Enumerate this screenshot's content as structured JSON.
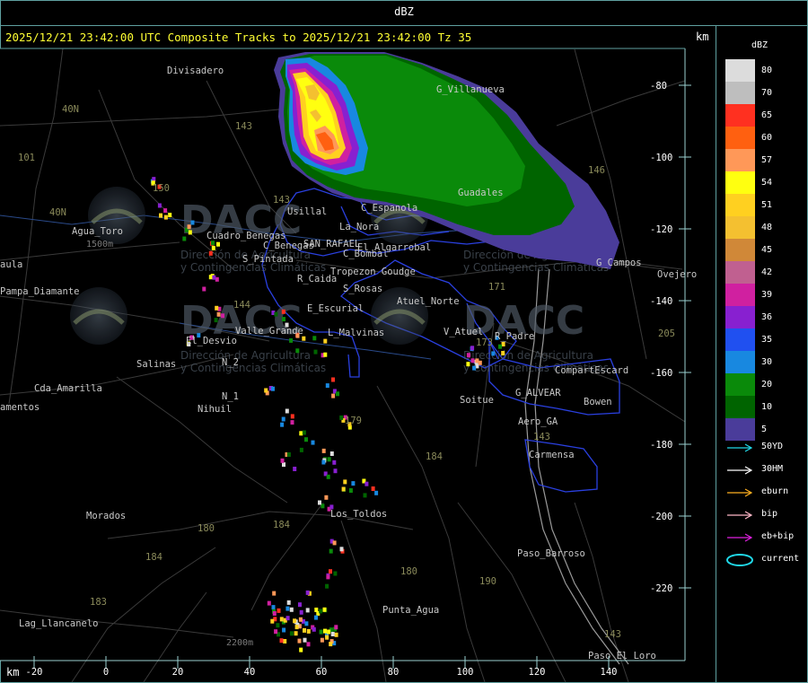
{
  "header": {
    "title": "dBZ"
  },
  "subtitle": "2025/12/21 23:42:00 UTC Composite Tracks to 2025/12/21 23:42:00 Tz 35",
  "axis_unit_top": "km",
  "axis_unit_bottom": "km",
  "y_ticks": [
    "-80",
    "-100",
    "-120",
    "-140",
    "-160",
    "-180",
    "-200",
    "-220"
  ],
  "x_ticks": [
    "-20",
    "0",
    "20",
    "40",
    "60",
    "80",
    "100",
    "120",
    "140"
  ],
  "legend": {
    "title": "dBZ",
    "levels": [
      {
        "label": "80",
        "color": "#dcdcdc"
      },
      {
        "label": "70",
        "color": "#bebebe"
      },
      {
        "label": "65",
        "color": "#ff3020"
      },
      {
        "label": "60",
        "color": "#ff6010"
      },
      {
        "label": "57",
        "color": "#ff9858"
      },
      {
        "label": "54",
        "color": "#ffff10"
      },
      {
        "label": "51",
        "color": "#ffd020"
      },
      {
        "label": "48",
        "color": "#f4c030"
      },
      {
        "label": "45",
        "color": "#d08838"
      },
      {
        "label": "42",
        "color": "#c06090"
      },
      {
        "label": "39",
        "color": "#d020a0"
      },
      {
        "label": "36",
        "color": "#8820d0"
      },
      {
        "label": "35",
        "color": "#2050f0"
      },
      {
        "label": "30",
        "color": "#1888e0"
      },
      {
        "label": "20",
        "color": "#0a8a0a"
      },
      {
        "label": "10",
        "color": "#006400"
      },
      {
        "label": "5",
        "color": "#4a3c9a"
      }
    ]
  },
  "tracks": [
    {
      "label": "50YD",
      "color": "#20d8e8"
    },
    {
      "label": "30HM",
      "color": "#ffffff"
    },
    {
      "label": "eburn",
      "color": "#ffb020"
    },
    {
      "label": "bip",
      "color": "#ffb8c8"
    },
    {
      "label": "eb+bip",
      "color": "#e020e0"
    },
    {
      "label": "current",
      "color": "#20d8e8"
    }
  ],
  "watermark": {
    "name": "DACC",
    "line1": "Dirección de Agricultura",
    "line2": "y Contingencias Climáticas"
  },
  "places": [
    {
      "name": "Divisadero",
      "color": "#c8c8c8"
    },
    {
      "name": "G_Villanueva",
      "color": "#c8c8c8"
    },
    {
      "name": "Guadales",
      "color": "#c8c8c8"
    },
    {
      "name": "Usillal",
      "color": "#c8c8c8"
    },
    {
      "name": "C_Espanola",
      "color": "#c8c8c8"
    },
    {
      "name": "La_Nora",
      "color": "#c8c8c8"
    },
    {
      "name": "Agua_Toro",
      "color": "#c8c8c8"
    },
    {
      "name": "Cuadro_Benegas",
      "color": "#c8c8c8"
    },
    {
      "name": "C_Benegas",
      "color": "#c8c8c8"
    },
    {
      "name": "SAN_RAFAEL",
      "color": "#c8c8c8"
    },
    {
      "name": "El_Algarrobal",
      "color": "#c8c8c8"
    },
    {
      "name": "C_Bombal",
      "color": "#c8c8c8"
    },
    {
      "name": "S_Pintada",
      "color": "#c8c8c8"
    },
    {
      "name": "Tropezon Goudge",
      "color": "#c8c8c8"
    },
    {
      "name": "R_Caida",
      "color": "#c8c8c8"
    },
    {
      "name": "S_Rosas",
      "color": "#c8c8c8"
    },
    {
      "name": "Atuel_Norte",
      "color": "#c8c8c8"
    },
    {
      "name": "E_Escurial",
      "color": "#c8c8c8"
    },
    {
      "name": "Valle_Grande",
      "color": "#c8c8c8"
    },
    {
      "name": "El_Desvio",
      "color": "#c8c8c8"
    },
    {
      "name": "L_Malvinas",
      "color": "#c8c8c8"
    },
    {
      "name": "V_Atuel",
      "color": "#c8c8c8"
    },
    {
      "name": "R_Padre",
      "color": "#c8c8c8"
    },
    {
      "name": "Salinas",
      "color": "#c8c8c8"
    },
    {
      "name": "N_2",
      "color": "#c8c8c8"
    },
    {
      "name": "N_1",
      "color": "#c8c8c8"
    },
    {
      "name": "Nihuil",
      "color": "#c8c8c8"
    },
    {
      "name": "CompartEscard",
      "color": "#c8c8c8"
    },
    {
      "name": "G_ALVEAR",
      "color": "#c8c8c8"
    },
    {
      "name": "Soitue",
      "color": "#c8c8c8"
    },
    {
      "name": "Bowen",
      "color": "#c8c8c8"
    },
    {
      "name": "Aero_GA",
      "color": "#c8c8c8"
    },
    {
      "name": "Carmensa",
      "color": "#c8c8c8"
    },
    {
      "name": "Cda_Amarilla",
      "color": "#c8c8c8"
    },
    {
      "name": "Pampa_Diamante",
      "color": "#c8c8c8"
    },
    {
      "name": "Los_Toldos",
      "color": "#c8c8c8"
    },
    {
      "name": "Morados",
      "color": "#c8c8c8"
    },
    {
      "name": "Paso_Barroso",
      "color": "#c8c8c8"
    },
    {
      "name": "Punta_Agua",
      "color": "#c8c8c8"
    },
    {
      "name": "Lag_Llancanelo",
      "color": "#c8c8c8"
    },
    {
      "name": "Paso_El_Loro",
      "color": "#c8c8c8"
    },
    {
      "name": "Ovejero",
      "color": "#c8c8c8"
    },
    {
      "name": "G_Campos",
      "color": "#c8c8c8"
    },
    {
      "name": "aula",
      "color": "#c8c8c8"
    },
    {
      "name": "amentos",
      "color": "#c8c8c8"
    }
  ],
  "route_numbers": [
    "143",
    "40N",
    "101",
    "150",
    "143",
    "40N",
    "146",
    "144",
    "171",
    "173",
    "184",
    "179",
    "180",
    "190",
    "184",
    "183",
    "184",
    "180",
    "205",
    "143",
    "143"
  ],
  "elevation_labels": [
    "1500m",
    "2200m"
  ]
}
